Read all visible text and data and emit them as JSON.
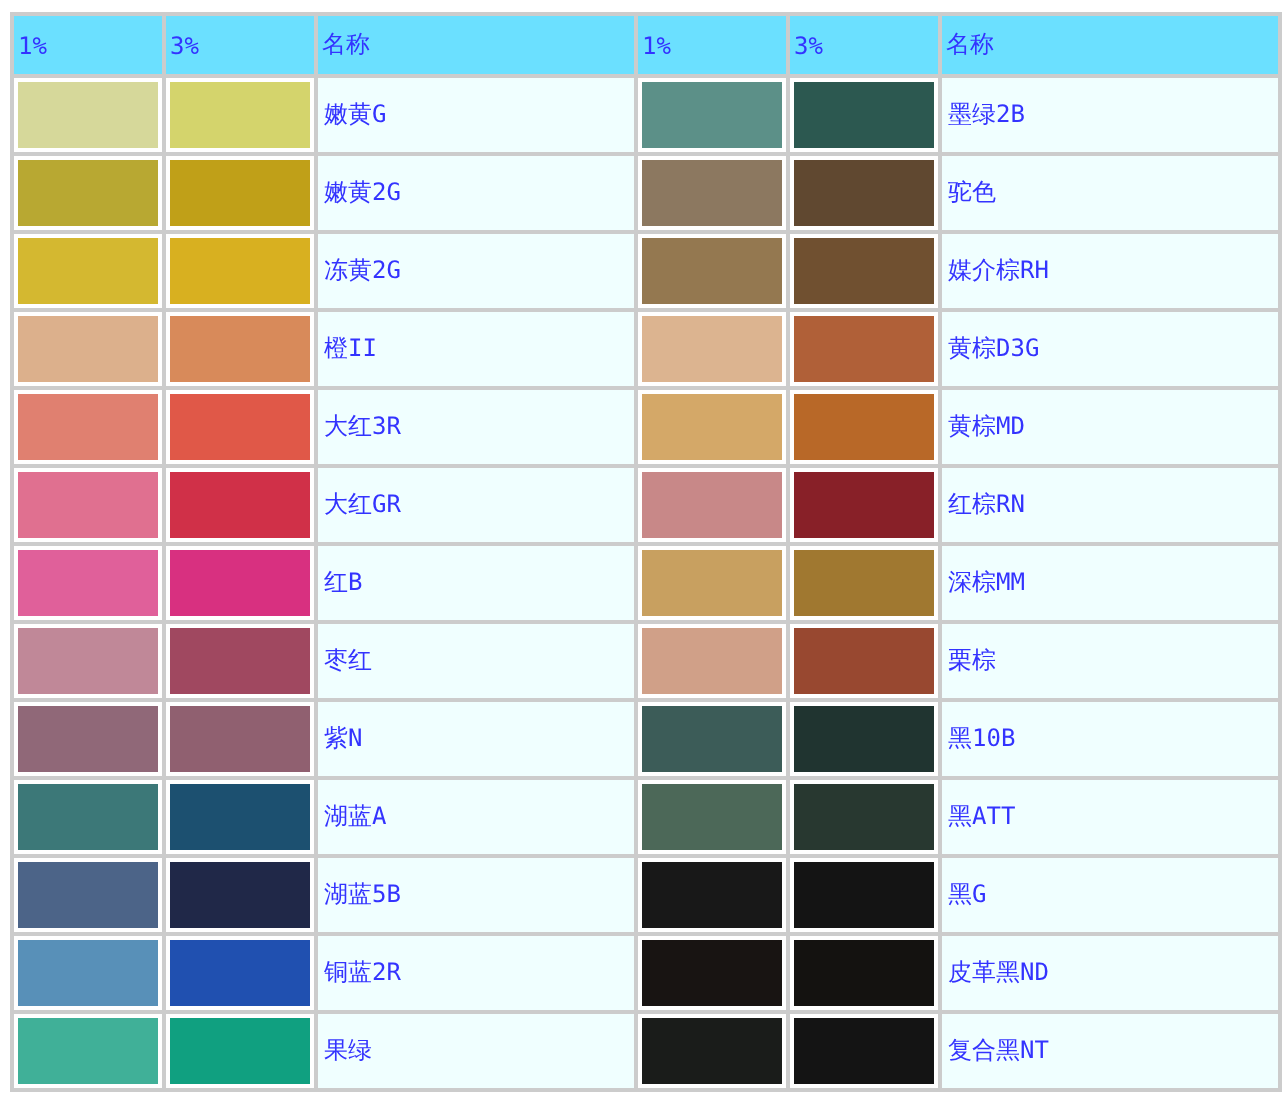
{
  "table": {
    "columns": [
      "1%",
      "3%",
      "名称",
      "1%",
      "3%",
      "名称"
    ],
    "rows": [
      {
        "entries": [
          {
            "name": "嫩黄G",
            "swatches": [
              {
                "color": "#d6d89a"
              },
              {
                "color": "#d4d46c"
              }
            ]
          },
          {
            "name": "墨绿2B",
            "swatches": [
              {
                "color": "#5c9088"
              },
              {
                "color": "#2c5850"
              }
            ]
          }
        ]
      },
      {
        "entries": [
          {
            "name": "嫩黄2G",
            "swatches": [
              {
                "color": "#b8a832"
              },
              {
                "color": "#c0a018"
              }
            ]
          },
          {
            "name": "驼色",
            "swatches": [
              {
                "color": "#8c7860"
              },
              {
                "color": "#604830"
              }
            ]
          }
        ]
      },
      {
        "entries": [
          {
            "name": "冻黄2G",
            "swatches": [
              {
                "color": "#d4b830"
              },
              {
                "color": "#d8b020"
              }
            ]
          },
          {
            "name": "媒介棕RH",
            "swatches": [
              {
                "color": "#947850"
              },
              {
                "color": "#705030"
              }
            ]
          }
        ]
      },
      {
        "entries": [
          {
            "name": "橙II",
            "swatches": [
              {
                "color": "#dcb08c"
              },
              {
                "color": "#d88a5a"
              }
            ]
          },
          {
            "name": "黄棕D3G",
            "swatches": [
              {
                "color": "#dcb490"
              },
              {
                "color": "#b06038"
              }
            ]
          }
        ]
      },
      {
        "entries": [
          {
            "name": "大红3R",
            "swatches": [
              {
                "color": "#e08070"
              },
              {
                "color": "#e05848"
              }
            ]
          },
          {
            "name": "黄棕MD",
            "swatches": [
              {
                "color": "#d4a868"
              },
              {
                "color": "#b86828"
              }
            ]
          }
        ]
      },
      {
        "entries": [
          {
            "name": "大红GR",
            "swatches": [
              {
                "color": "#e07090"
              },
              {
                "color": "#d03048"
              }
            ]
          },
          {
            "name": "红棕RN",
            "swatches": [
              {
                "color": "#c88888"
              },
              {
                "color": "#882028"
              }
            ]
          }
        ]
      },
      {
        "entries": [
          {
            "name": "红B",
            "swatches": [
              {
                "color": "#e0609a"
              },
              {
                "color": "#d83080"
              }
            ]
          },
          {
            "name": "深棕MM",
            "swatches": [
              {
                "color": "#c8a060"
              },
              {
                "color": "#a07830"
              }
            ]
          }
        ]
      },
      {
        "entries": [
          {
            "name": "枣红",
            "swatches": [
              {
                "color": "#c08898"
              },
              {
                "color": "#a04860"
              }
            ]
          },
          {
            "name": "栗棕",
            "swatches": [
              {
                "color": "#d0a088"
              },
              {
                "color": "#984830"
              }
            ]
          }
        ]
      },
      {
        "entries": [
          {
            "name": "紫N",
            "swatches": [
              {
                "color": "#906878"
              },
              {
                "color": "#906070"
              }
            ]
          },
          {
            "name": "黑10B",
            "swatches": [
              {
                "color": "#3c5c58"
              },
              {
                "color": "#203430"
              }
            ]
          }
        ]
      },
      {
        "entries": [
          {
            "name": "湖蓝A",
            "swatches": [
              {
                "color": "#3c7878"
              },
              {
                "color": "#1c5070"
              }
            ]
          },
          {
            "name": "黑ATT",
            "swatches": [
              {
                "color": "#4c6858"
              },
              {
                "color": "#283830"
              }
            ]
          }
        ]
      },
      {
        "entries": [
          {
            "name": "湖蓝5B",
            "swatches": [
              {
                "color": "#4c6488"
              },
              {
                "color": "#202848"
              }
            ]
          },
          {
            "name": "黑G",
            "swatches": [
              {
                "color": "#181818"
              },
              {
                "color": "#141414"
              }
            ]
          }
        ]
      },
      {
        "entries": [
          {
            "name": "铜蓝2R",
            "swatches": [
              {
                "color": "#5890b8"
              },
              {
                "color": "#2050b0"
              }
            ]
          },
          {
            "name": "皮革黑ND",
            "swatches": [
              {
                "color": "#181412"
              },
              {
                "color": "#141210"
              }
            ]
          }
        ]
      },
      {
        "entries": [
          {
            "name": "果绿",
            "swatches": [
              {
                "color": "#40b098"
              },
              {
                "color": "#10a080"
              }
            ]
          },
          {
            "name": "复合黑NT",
            "swatches": [
              {
                "color": "#1a1c1a"
              },
              {
                "color": "#141414"
              }
            ]
          }
        ]
      }
    ]
  }
}
